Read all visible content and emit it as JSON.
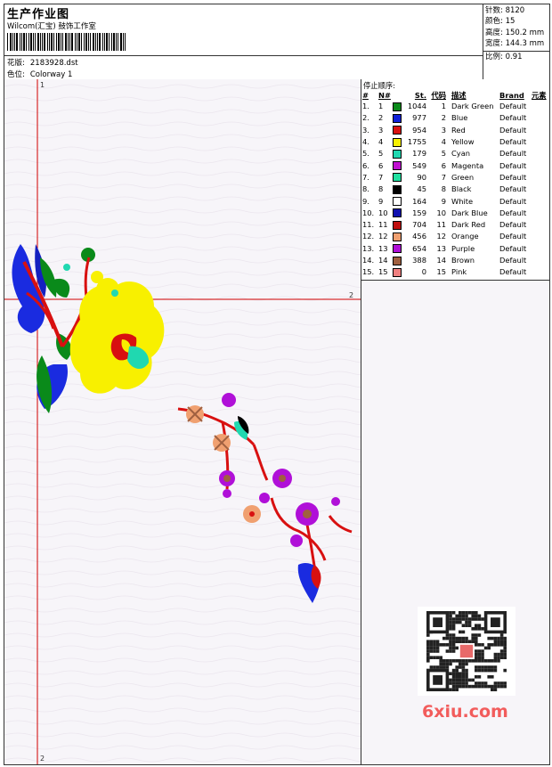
{
  "header": {
    "title": "生产作业图",
    "company": "Wilcom(汇宝) 鼓饰工作室",
    "design_label": "花版:",
    "design_value": "2183928.dst",
    "colorway_label": "色位:",
    "colorway_value": "Colorway 1"
  },
  "stats": {
    "stitches_label": "针数:",
    "stitches_value": "8120",
    "colors_label": "颜色:",
    "colors_value": "15",
    "height_label": "高度:",
    "height_value": "150.2 mm",
    "width_label": "宽度:",
    "width_value": "144.3 mm",
    "scale_label": "比例:",
    "scale_value": "0.91"
  },
  "stop_sequence": {
    "title": "停止顺序:",
    "headers": {
      "idx": "#",
      "n": "N#",
      "st": "St.",
      "code": "代码",
      "desc": "描述",
      "brand": "Brand",
      "elem": "元素"
    },
    "rows": [
      {
        "idx": "1.",
        "n": "1",
        "color": "#0a8a1a",
        "st": "1044",
        "code": "1",
        "desc": "Dark Green",
        "brand": "Default"
      },
      {
        "idx": "2.",
        "n": "2",
        "color": "#1020d8",
        "st": "977",
        "code": "2",
        "desc": "Blue",
        "brand": "Default"
      },
      {
        "idx": "3.",
        "n": "3",
        "color": "#d81010",
        "st": "954",
        "code": "3",
        "desc": "Red",
        "brand": "Default"
      },
      {
        "idx": "4.",
        "n": "4",
        "color": "#f8f000",
        "st": "1755",
        "code": "4",
        "desc": "Yellow",
        "brand": "Default"
      },
      {
        "idx": "5.",
        "n": "5",
        "color": "#20d8b0",
        "st": "179",
        "code": "5",
        "desc": "Cyan",
        "brand": "Default"
      },
      {
        "idx": "6.",
        "n": "6",
        "color": "#c010d0",
        "st": "549",
        "code": "6",
        "desc": "Magenta",
        "brand": "Default"
      },
      {
        "idx": "7.",
        "n": "7",
        "color": "#20e0a0",
        "st": "90",
        "code": "7",
        "desc": "Green",
        "brand": "Default"
      },
      {
        "idx": "8.",
        "n": "8",
        "color": "#000000",
        "st": "45",
        "code": "8",
        "desc": "Black",
        "brand": "Default"
      },
      {
        "idx": "9.",
        "n": "9",
        "color": "#ffffff",
        "st": "164",
        "code": "9",
        "desc": "White",
        "brand": "Default"
      },
      {
        "idx": "10.",
        "n": "10",
        "color": "#1010b0",
        "st": "159",
        "code": "10",
        "desc": "Dark Blue",
        "brand": "Default"
      },
      {
        "idx": "11.",
        "n": "11",
        "color": "#c01010",
        "st": "704",
        "code": "11",
        "desc": "Dark Red",
        "brand": "Default"
      },
      {
        "idx": "12.",
        "n": "12",
        "color": "#f0a070",
        "st": "456",
        "code": "12",
        "desc": "Orange",
        "brand": "Default"
      },
      {
        "idx": "13.",
        "n": "13",
        "color": "#b010d8",
        "st": "654",
        "code": "13",
        "desc": "Purple",
        "brand": "Default"
      },
      {
        "idx": "14.",
        "n": "14",
        "color": "#a06040",
        "st": "388",
        "code": "14",
        "desc": "Brown",
        "brand": "Default"
      },
      {
        "idx": "15.",
        "n": "15",
        "color": "#f08080",
        "st": "0",
        "code": "15",
        "desc": "Pink",
        "brand": "Default"
      }
    ]
  },
  "axis_markers": {
    "top": "1",
    "right": "2",
    "bottom": "2"
  },
  "watermark": "6xiu.com",
  "colors": {
    "guide_line": "#d00000",
    "canvas_bg": "#f7f5f9"
  }
}
